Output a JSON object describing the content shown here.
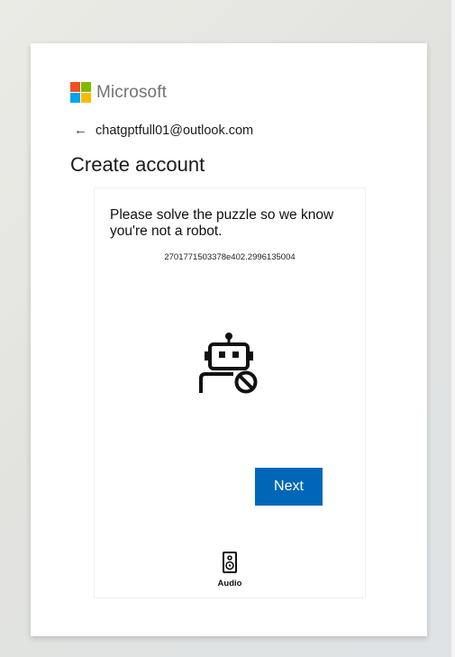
{
  "brand": {
    "name": "Microsoft",
    "colors": [
      "#f25022",
      "#7fba00",
      "#00a4ef",
      "#ffb900"
    ]
  },
  "header": {
    "identity_email": "chatgptfull01@outlook.com",
    "back_icon": "arrow-left-icon",
    "title": "Create account"
  },
  "puzzle": {
    "instruction": "Please solve the puzzle so we know you're not a robot.",
    "session_id": "2701771503378e402.2996135004",
    "robot_icon": "robot-blocked-icon",
    "next_label": "Next",
    "audio_label": "Audio",
    "audio_icon": "speaker-icon"
  },
  "colors": {
    "accent": "#0067b8",
    "text": "#1b1b1b",
    "logo_text": "#737373"
  }
}
